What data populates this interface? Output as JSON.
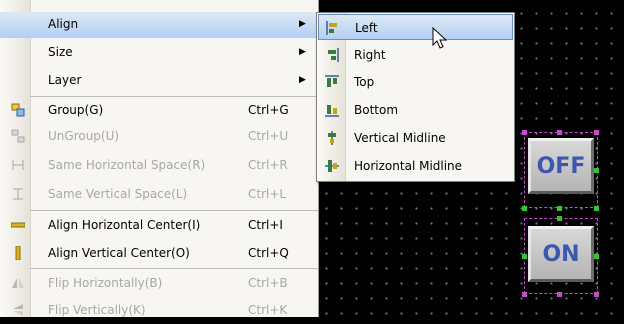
{
  "main_menu": {
    "items": [
      {
        "label": "Align",
        "shortcut": "",
        "submenu": true,
        "disabled": false,
        "icon": "none",
        "selected": true
      },
      {
        "label": "Size",
        "shortcut": "",
        "submenu": true,
        "disabled": false,
        "icon": "none"
      },
      {
        "label": "Layer",
        "shortcut": "",
        "submenu": true,
        "disabled": false,
        "icon": "none"
      },
      {
        "label": "Group(G)",
        "shortcut": "Ctrl+G",
        "disabled": false,
        "icon": "group-icon"
      },
      {
        "label": "UnGroup(U)",
        "shortcut": "Ctrl+U",
        "disabled": true,
        "icon": "ungroup-icon"
      },
      {
        "label": "Same Horizontal Space(R)",
        "shortcut": "Ctrl+R",
        "disabled": true,
        "icon": "same-horizontal-space-icon"
      },
      {
        "label": "Same Vertical Space(L)",
        "shortcut": "Ctrl+L",
        "disabled": true,
        "icon": "same-vertical-space-icon"
      },
      {
        "label": "Align Horizontal Center(I)",
        "shortcut": "Ctrl+I",
        "disabled": false,
        "icon": "align-horizontal-center-icon"
      },
      {
        "label": "Align Vertical Center(O)",
        "shortcut": "Ctrl+Q",
        "disabled": false,
        "icon": "align-vertical-center-icon"
      },
      {
        "label": "Flip Horizontally(B)",
        "shortcut": "Ctrl+B",
        "disabled": true,
        "icon": "flip-horizontal-icon"
      },
      {
        "label": "Flip Vertically(K)",
        "shortcut": "Ctrl+K",
        "disabled": true,
        "icon": "flip-vertical-icon"
      }
    ],
    "submenu_arrow": "▶"
  },
  "align_submenu": {
    "items": [
      {
        "label": "Left",
        "icon": "align-left-icon",
        "selected": true
      },
      {
        "label": "Right",
        "icon": "align-right-icon"
      },
      {
        "label": "Top",
        "icon": "align-top-icon"
      },
      {
        "label": "Bottom",
        "icon": "align-bottom-icon"
      },
      {
        "label": "Vertical Midline",
        "icon": "vertical-midline-icon"
      },
      {
        "label": "Horizontal Midline",
        "icon": "horizontal-midline-icon"
      }
    ]
  },
  "canvas": {
    "buttons": [
      {
        "label": "OFF"
      },
      {
        "label": "ON"
      }
    ]
  },
  "colors": {
    "selection_highlight": "#b3cff0",
    "canvas_background": "#000000",
    "button_text": "#3a58b0",
    "handle_pink": "#c34fc3",
    "handle_green": "#34c234"
  }
}
